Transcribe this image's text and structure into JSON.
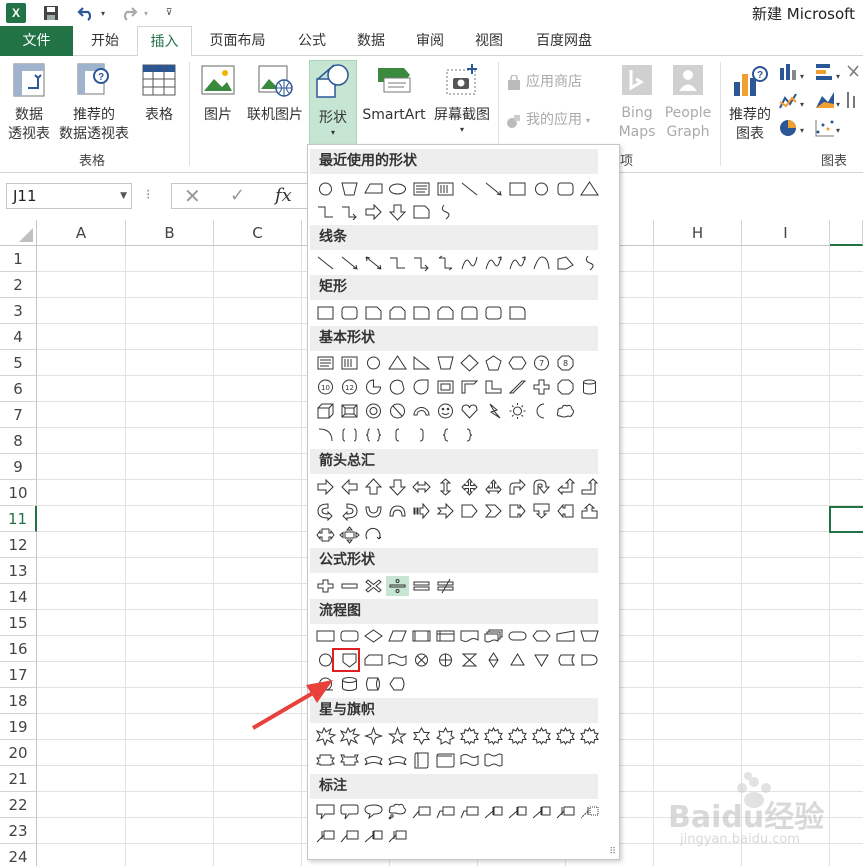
{
  "app": {
    "logo": "X",
    "title": "新建 Microsoft"
  },
  "tabs": [
    {
      "label": "文件"
    },
    {
      "label": "开始"
    },
    {
      "label": "插入"
    },
    {
      "label": "页面布局"
    },
    {
      "label": "公式"
    },
    {
      "label": "数据"
    },
    {
      "label": "审阅"
    },
    {
      "label": "视图"
    },
    {
      "label": "百度网盘"
    }
  ],
  "ribbon": {
    "pivot_line1": "数据",
    "pivot_line2": "透视表",
    "rec_pivot_line1": "推荐的",
    "rec_pivot_line2": "数据透视表",
    "table": "表格",
    "group_tables": "表格",
    "picture": "图片",
    "online_picture": "联机图片",
    "shapes": "形状",
    "smartart": "SmartArt",
    "screenshot": "屏幕截图",
    "app_store": "应用商店",
    "my_apps": "我的应用",
    "group_apps_partial": "项",
    "bing_line1": "Bing",
    "bing_line2": "Maps",
    "people_line1": "People",
    "people_line2": "Graph",
    "rec_chart_line1": "推荐的",
    "rec_chart_line2": "图表",
    "group_charts": "图表"
  },
  "formula_bar": {
    "name_box": "J11",
    "fx": "fx"
  },
  "columns": [
    "A",
    "B",
    "C",
    "H",
    "I"
  ],
  "rows": [
    "1",
    "2",
    "3",
    "4",
    "5",
    "6",
    "7",
    "8",
    "9",
    "10",
    "11",
    "12",
    "13",
    "14",
    "15",
    "16",
    "17",
    "18",
    "19",
    "20",
    "21",
    "22",
    "23",
    "24"
  ],
  "selected_cell": "J11",
  "shapes_menu": {
    "sections": [
      {
        "title": "最近使用的形状"
      },
      {
        "title": "线条"
      },
      {
        "title": "矩形"
      },
      {
        "title": "基本形状"
      },
      {
        "title": "箭头总汇"
      },
      {
        "title": "公式形状"
      },
      {
        "title": "流程图"
      },
      {
        "title": "星与旗帜"
      },
      {
        "title": "标注"
      }
    ],
    "highlighted_shape": "flowchart-offpage-connector-icon"
  },
  "colors": {
    "accent": "#217346",
    "highlight": "#e02020",
    "arrow": "#e8403a"
  },
  "watermark": {
    "text": "Baidu经验",
    "url": "jingyan.baidu.com"
  }
}
